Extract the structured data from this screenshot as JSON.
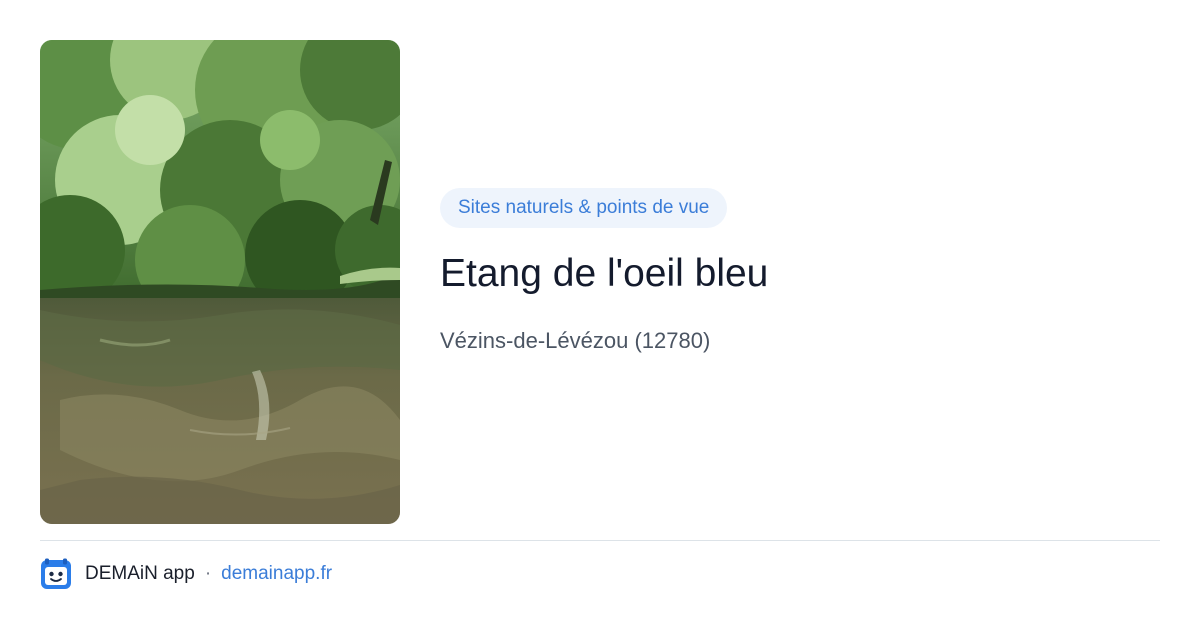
{
  "card": {
    "category": "Sites naturels & points de vue",
    "title": "Etang de l'oeil bleu",
    "location": "Vézins-de-Lévézou (12780)"
  },
  "footer": {
    "app_name": "DEMAiN app",
    "separator": "·",
    "site": "demainapp.fr",
    "app_icon": "calendar-face-icon"
  },
  "colors": {
    "accent": "#3b7dd8",
    "badge_bg": "#eef4fc",
    "title": "#141b2d",
    "subtitle": "#4b5563"
  }
}
